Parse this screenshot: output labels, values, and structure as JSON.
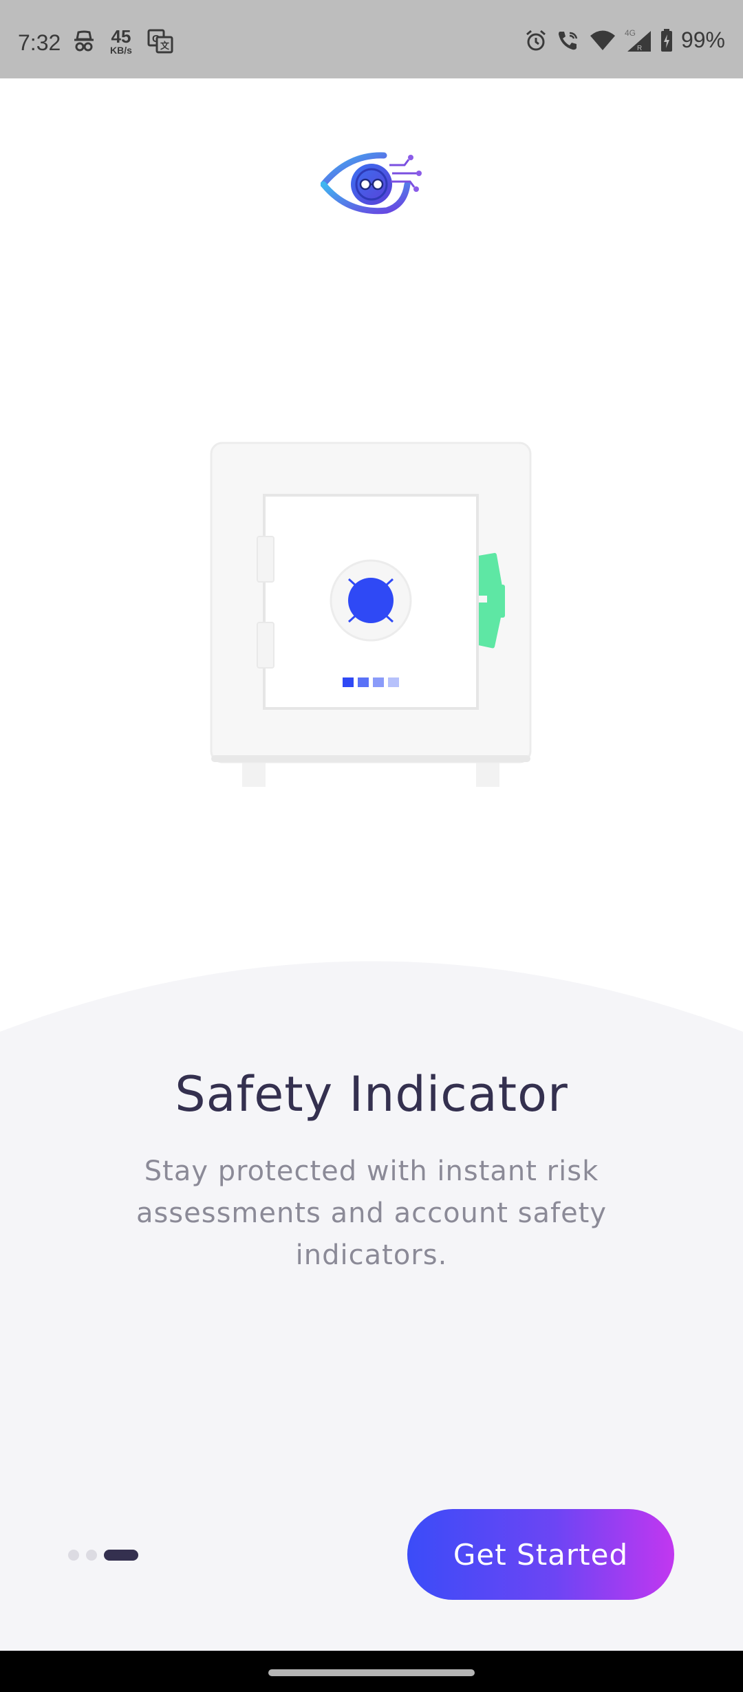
{
  "status_bar": {
    "time": "7:32",
    "net_speed_value": "45",
    "net_speed_unit": "KB/s",
    "battery": "99%",
    "icons": [
      "incognito-icon",
      "translate-icon",
      "alarm-icon",
      "wifi-call-icon",
      "wifi-icon",
      "signal-4g-icon",
      "battery-charging-icon"
    ]
  },
  "onboarding": {
    "title": "Safety Indicator",
    "description": "Stay protected with instant risk assessments and account safety indicators.",
    "cta_label": "Get Started",
    "page_count": 3,
    "current_page": 3
  },
  "colors": {
    "title": "#34304f",
    "description": "#8b8a97",
    "panel_bg": "#f5f5f8",
    "button_start": "#3b4cf8",
    "button_end": "#c237f0",
    "dial": "#2f49f5",
    "cash": "#5ee7a4"
  }
}
